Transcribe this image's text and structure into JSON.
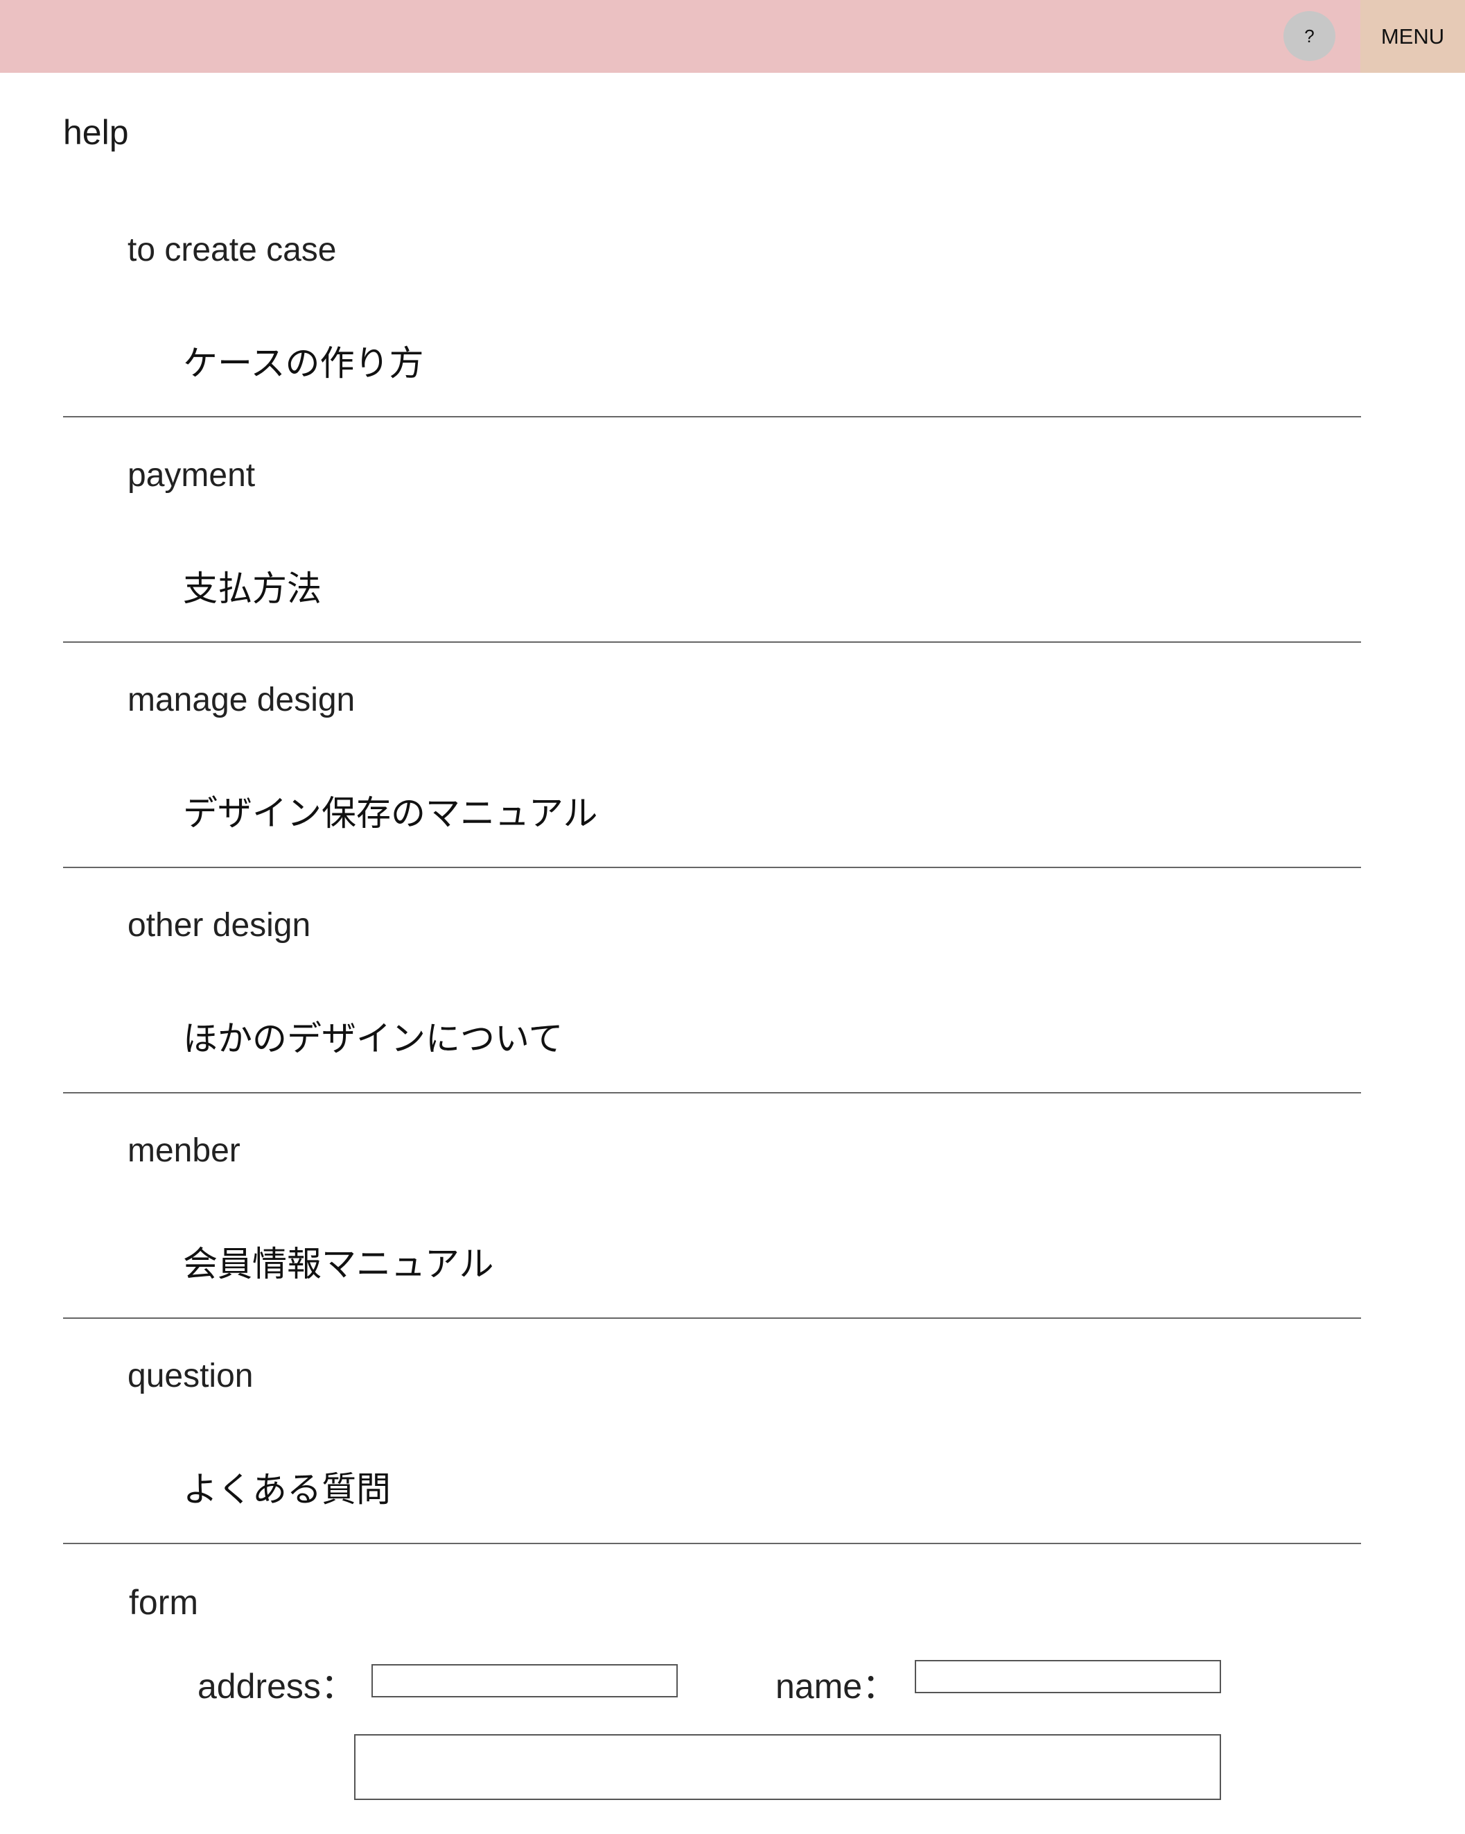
{
  "header": {
    "help_icon_glyph": "?",
    "menu_label": "MENU",
    "bar_color": "#ebc1c2",
    "menu_color": "#e6cab6"
  },
  "page": {
    "title": "help"
  },
  "sections": [
    {
      "en": "to create case",
      "jp": "ケースの作り方"
    },
    {
      "en": "payment",
      "jp": "支払方法"
    },
    {
      "en": "manage design",
      "jp": "デザイン保存のマニュアル"
    },
    {
      "en": "other design",
      "jp": "ほかのデザインについて"
    },
    {
      "en": "menber",
      "jp": "会員情報マニュアル"
    },
    {
      "en": "question",
      "jp": "よくある質問"
    }
  ],
  "form": {
    "title": "form",
    "address_label": "address：",
    "address_value": "",
    "name_label": "name：",
    "name_value": "",
    "message_value": ""
  }
}
